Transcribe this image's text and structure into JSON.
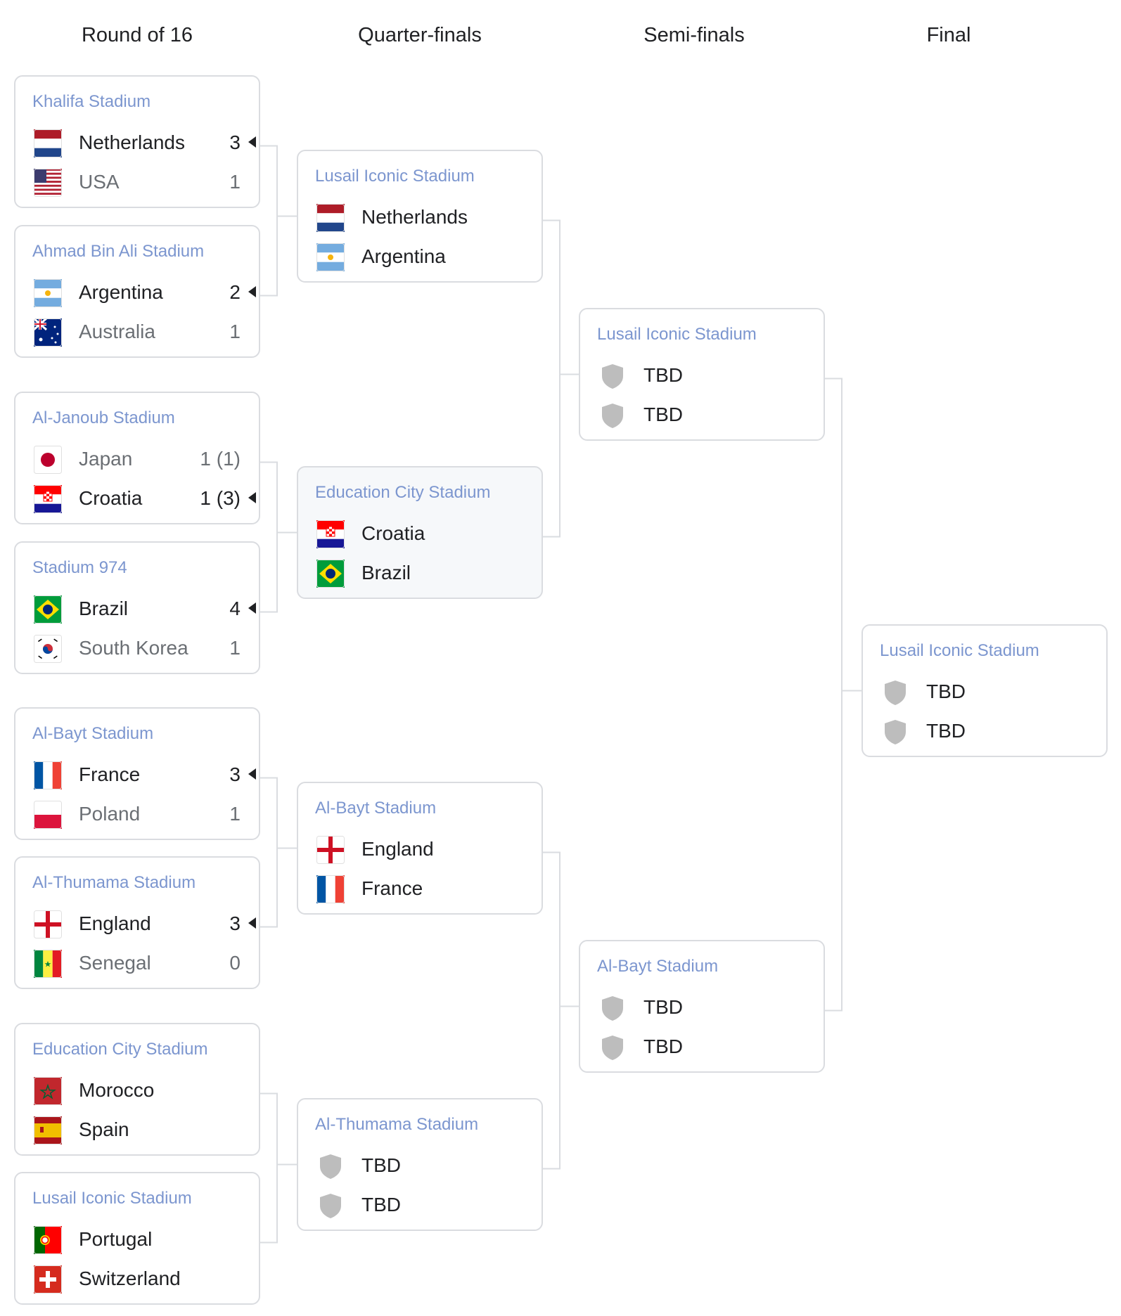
{
  "rounds": [
    "Round of 16",
    "Quarter-finals",
    "Semi-finals",
    "Final"
  ],
  "r16": [
    {
      "venue": "Khalifa Stadium",
      "t1": {
        "name": "Netherlands",
        "flag": "netherlands-flag",
        "score": "3",
        "winner": true
      },
      "t2": {
        "name": "USA",
        "flag": "usa-flag",
        "score": "1",
        "winner": false
      }
    },
    {
      "venue": "Ahmad Bin Ali Stadium",
      "t1": {
        "name": "Argentina",
        "flag": "argentina-flag",
        "score": "2",
        "winner": true
      },
      "t2": {
        "name": "Australia",
        "flag": "australia-flag",
        "score": "1",
        "winner": false
      }
    },
    {
      "venue": "Al-Janoub Stadium",
      "t1": {
        "name": "Japan",
        "flag": "japan-flag",
        "score": "1 (1)",
        "winner": false
      },
      "t2": {
        "name": "Croatia",
        "flag": "croatia-flag",
        "score": "1 (3)",
        "winner": true
      }
    },
    {
      "venue": "Stadium 974",
      "t1": {
        "name": "Brazil",
        "flag": "brazil-flag",
        "score": "4",
        "winner": true
      },
      "t2": {
        "name": "South Korea",
        "flag": "south-korea-flag",
        "score": "1",
        "winner": false
      }
    },
    {
      "venue": "Al-Bayt Stadium",
      "t1": {
        "name": "France",
        "flag": "france-flag",
        "score": "3",
        "winner": true
      },
      "t2": {
        "name": "Poland",
        "flag": "poland-flag",
        "score": "1",
        "winner": false
      }
    },
    {
      "venue": "Al-Thumama Stadium",
      "t1": {
        "name": "England",
        "flag": "england-flag",
        "score": "3",
        "winner": true
      },
      "t2": {
        "name": "Senegal",
        "flag": "senegal-flag",
        "score": "0",
        "winner": false
      }
    },
    {
      "venue": "Education City Stadium",
      "t1": {
        "name": "Morocco",
        "flag": "morocco-flag",
        "score": "",
        "winner": false
      },
      "t2": {
        "name": "Spain",
        "flag": "spain-flag",
        "score": "",
        "winner": false
      }
    },
    {
      "venue": "Lusail Iconic Stadium",
      "t1": {
        "name": "Portugal",
        "flag": "portugal-flag",
        "score": "",
        "winner": false
      },
      "t2": {
        "name": "Switzerland",
        "flag": "switzerland-flag",
        "score": "",
        "winner": false
      }
    }
  ],
  "qf": [
    {
      "venue": "Lusail Iconic Stadium",
      "t1": {
        "name": "Netherlands",
        "flag": "netherlands-flag"
      },
      "t2": {
        "name": "Argentina",
        "flag": "argentina-flag"
      }
    },
    {
      "venue": "Education City Stadium",
      "highlight": true,
      "t1": {
        "name": "Croatia",
        "flag": "croatia-flag"
      },
      "t2": {
        "name": "Brazil",
        "flag": "brazil-flag"
      }
    },
    {
      "venue": "Al-Bayt Stadium",
      "t1": {
        "name": "England",
        "flag": "england-flag"
      },
      "t2": {
        "name": "France",
        "flag": "france-flag"
      }
    },
    {
      "venue": "Al-Thumama Stadium",
      "t1": {
        "name": "TBD",
        "flag": "shield"
      },
      "t2": {
        "name": "TBD",
        "flag": "shield"
      }
    }
  ],
  "sf": [
    {
      "venue": "Lusail Iconic Stadium",
      "t1": {
        "name": "TBD",
        "flag": "shield"
      },
      "t2": {
        "name": "TBD",
        "flag": "shield"
      }
    },
    {
      "venue": "Al-Bayt Stadium",
      "t1": {
        "name": "TBD",
        "flag": "shield"
      },
      "t2": {
        "name": "TBD",
        "flag": "shield"
      }
    }
  ],
  "final": [
    {
      "venue": "Lusail Iconic Stadium",
      "t1": {
        "name": "TBD",
        "flag": "shield"
      },
      "t2": {
        "name": "TBD",
        "flag": "shield"
      }
    }
  ],
  "colors": {
    "venue": "#7c96cf",
    "border": "#dadce0",
    "connector": "#dadce0",
    "shield": "#bdbdbd"
  }
}
